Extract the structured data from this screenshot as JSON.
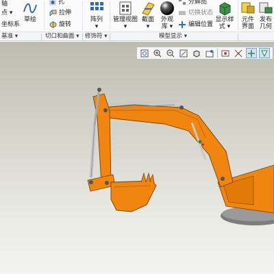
{
  "ribbon": {
    "col1": {
      "axis": "轴",
      "point": "点 ▾",
      "coordsys": "坐标系"
    },
    "sketch": {
      "label": "草绘"
    },
    "cut": {
      "hole": "孔",
      "extrude": "拉伸",
      "revolve": "旋转"
    },
    "pattern": {
      "label": "阵列",
      "arrow": "▾"
    },
    "manage_view": {
      "label": "管理视图",
      "arrow": "▾"
    },
    "section": {
      "label": "截面",
      "arrow": "▾"
    },
    "appearance": {
      "line1": "外观",
      "line2": "库 ▾"
    },
    "explode": {
      "label": "分解图",
      "toggle": "切换状态",
      "edit_pos": "编辑位置"
    },
    "display_style": {
      "line1": "显示样",
      "line2": "式 ▾"
    },
    "component_ui": {
      "line1": "元件",
      "line2": "界面"
    },
    "publish": {
      "line1": "发布",
      "line2": "几何"
    }
  },
  "groups": {
    "datum": "基准 ▾",
    "cut_surface": "切口和曲面 ▾",
    "modifiers": "修饰符 ▾",
    "model_display": "模型显示 ▾"
  },
  "view_toolbar": {
    "items": [
      "refit-icon",
      "zoom-in-icon",
      "zoom-out-icon",
      "repaint-icon",
      "shading-icon",
      "saved-views-icon",
      "view-manager-icon",
      "datum-display-icon",
      "spin-center-icon",
      "annotation-display-icon"
    ],
    "active": [
      "datum-display-icon",
      "spin-center-icon"
    ]
  },
  "colors": {
    "excavator": "#f0860f",
    "excavator_dark": "#b85f00",
    "cylinder": "#c8c8c8",
    "ribbon_bg": "#fbfbfc",
    "viewport_top": "#bcbcb0",
    "viewport_bottom": "#f3f3f0"
  }
}
